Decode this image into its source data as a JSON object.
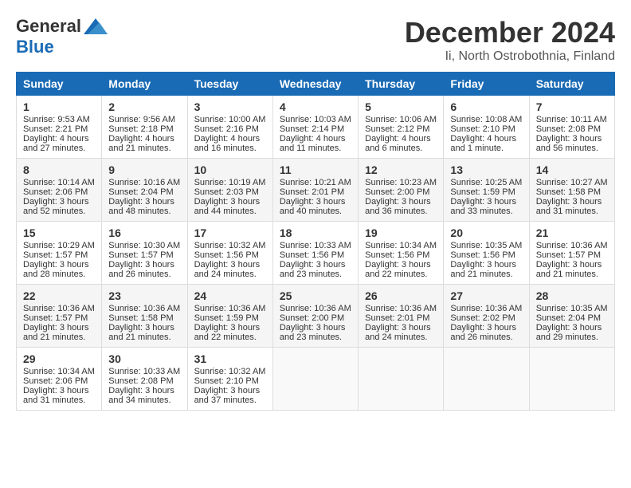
{
  "header": {
    "logo_general": "General",
    "logo_blue": "Blue",
    "month_title": "December 2024",
    "subtitle": "Ii, North Ostrobothnia, Finland"
  },
  "weekdays": [
    "Sunday",
    "Monday",
    "Tuesday",
    "Wednesday",
    "Thursday",
    "Friday",
    "Saturday"
  ],
  "weeks": [
    [
      {
        "day": "1",
        "sunrise": "Sunrise: 9:53 AM",
        "sunset": "Sunset: 2:21 PM",
        "daylight": "Daylight: 4 hours and 27 minutes."
      },
      {
        "day": "2",
        "sunrise": "Sunrise: 9:56 AM",
        "sunset": "Sunset: 2:18 PM",
        "daylight": "Daylight: 4 hours and 21 minutes."
      },
      {
        "day": "3",
        "sunrise": "Sunrise: 10:00 AM",
        "sunset": "Sunset: 2:16 PM",
        "daylight": "Daylight: 4 hours and 16 minutes."
      },
      {
        "day": "4",
        "sunrise": "Sunrise: 10:03 AM",
        "sunset": "Sunset: 2:14 PM",
        "daylight": "Daylight: 4 hours and 11 minutes."
      },
      {
        "day": "5",
        "sunrise": "Sunrise: 10:06 AM",
        "sunset": "Sunset: 2:12 PM",
        "daylight": "Daylight: 4 hours and 6 minutes."
      },
      {
        "day": "6",
        "sunrise": "Sunrise: 10:08 AM",
        "sunset": "Sunset: 2:10 PM",
        "daylight": "Daylight: 4 hours and 1 minute."
      },
      {
        "day": "7",
        "sunrise": "Sunrise: 10:11 AM",
        "sunset": "Sunset: 2:08 PM",
        "daylight": "Daylight: 3 hours and 56 minutes."
      }
    ],
    [
      {
        "day": "8",
        "sunrise": "Sunrise: 10:14 AM",
        "sunset": "Sunset: 2:06 PM",
        "daylight": "Daylight: 3 hours and 52 minutes."
      },
      {
        "day": "9",
        "sunrise": "Sunrise: 10:16 AM",
        "sunset": "Sunset: 2:04 PM",
        "daylight": "Daylight: 3 hours and 48 minutes."
      },
      {
        "day": "10",
        "sunrise": "Sunrise: 10:19 AM",
        "sunset": "Sunset: 2:03 PM",
        "daylight": "Daylight: 3 hours and 44 minutes."
      },
      {
        "day": "11",
        "sunrise": "Sunrise: 10:21 AM",
        "sunset": "Sunset: 2:01 PM",
        "daylight": "Daylight: 3 hours and 40 minutes."
      },
      {
        "day": "12",
        "sunrise": "Sunrise: 10:23 AM",
        "sunset": "Sunset: 2:00 PM",
        "daylight": "Daylight: 3 hours and 36 minutes."
      },
      {
        "day": "13",
        "sunrise": "Sunrise: 10:25 AM",
        "sunset": "Sunset: 1:59 PM",
        "daylight": "Daylight: 3 hours and 33 minutes."
      },
      {
        "day": "14",
        "sunrise": "Sunrise: 10:27 AM",
        "sunset": "Sunset: 1:58 PM",
        "daylight": "Daylight: 3 hours and 31 minutes."
      }
    ],
    [
      {
        "day": "15",
        "sunrise": "Sunrise: 10:29 AM",
        "sunset": "Sunset: 1:57 PM",
        "daylight": "Daylight: 3 hours and 28 minutes."
      },
      {
        "day": "16",
        "sunrise": "Sunrise: 10:30 AM",
        "sunset": "Sunset: 1:57 PM",
        "daylight": "Daylight: 3 hours and 26 minutes."
      },
      {
        "day": "17",
        "sunrise": "Sunrise: 10:32 AM",
        "sunset": "Sunset: 1:56 PM",
        "daylight": "Daylight: 3 hours and 24 minutes."
      },
      {
        "day": "18",
        "sunrise": "Sunrise: 10:33 AM",
        "sunset": "Sunset: 1:56 PM",
        "daylight": "Daylight: 3 hours and 23 minutes."
      },
      {
        "day": "19",
        "sunrise": "Sunrise: 10:34 AM",
        "sunset": "Sunset: 1:56 PM",
        "daylight": "Daylight: 3 hours and 22 minutes."
      },
      {
        "day": "20",
        "sunrise": "Sunrise: 10:35 AM",
        "sunset": "Sunset: 1:56 PM",
        "daylight": "Daylight: 3 hours and 21 minutes."
      },
      {
        "day": "21",
        "sunrise": "Sunrise: 10:36 AM",
        "sunset": "Sunset: 1:57 PM",
        "daylight": "Daylight: 3 hours and 21 minutes."
      }
    ],
    [
      {
        "day": "22",
        "sunrise": "Sunrise: 10:36 AM",
        "sunset": "Sunset: 1:57 PM",
        "daylight": "Daylight: 3 hours and 21 minutes."
      },
      {
        "day": "23",
        "sunrise": "Sunrise: 10:36 AM",
        "sunset": "Sunset: 1:58 PM",
        "daylight": "Daylight: 3 hours and 21 minutes."
      },
      {
        "day": "24",
        "sunrise": "Sunrise: 10:36 AM",
        "sunset": "Sunset: 1:59 PM",
        "daylight": "Daylight: 3 hours and 22 minutes."
      },
      {
        "day": "25",
        "sunrise": "Sunrise: 10:36 AM",
        "sunset": "Sunset: 2:00 PM",
        "daylight": "Daylight: 3 hours and 23 minutes."
      },
      {
        "day": "26",
        "sunrise": "Sunrise: 10:36 AM",
        "sunset": "Sunset: 2:01 PM",
        "daylight": "Daylight: 3 hours and 24 minutes."
      },
      {
        "day": "27",
        "sunrise": "Sunrise: 10:36 AM",
        "sunset": "Sunset: 2:02 PM",
        "daylight": "Daylight: 3 hours and 26 minutes."
      },
      {
        "day": "28",
        "sunrise": "Sunrise: 10:35 AM",
        "sunset": "Sunset: 2:04 PM",
        "daylight": "Daylight: 3 hours and 29 minutes."
      }
    ],
    [
      {
        "day": "29",
        "sunrise": "Sunrise: 10:34 AM",
        "sunset": "Sunset: 2:06 PM",
        "daylight": "Daylight: 3 hours and 31 minutes."
      },
      {
        "day": "30",
        "sunrise": "Sunrise: 10:33 AM",
        "sunset": "Sunset: 2:08 PM",
        "daylight": "Daylight: 3 hours and 34 minutes."
      },
      {
        "day": "31",
        "sunrise": "Sunrise: 10:32 AM",
        "sunset": "Sunset: 2:10 PM",
        "daylight": "Daylight: 3 hours and 37 minutes."
      },
      null,
      null,
      null,
      null
    ]
  ]
}
